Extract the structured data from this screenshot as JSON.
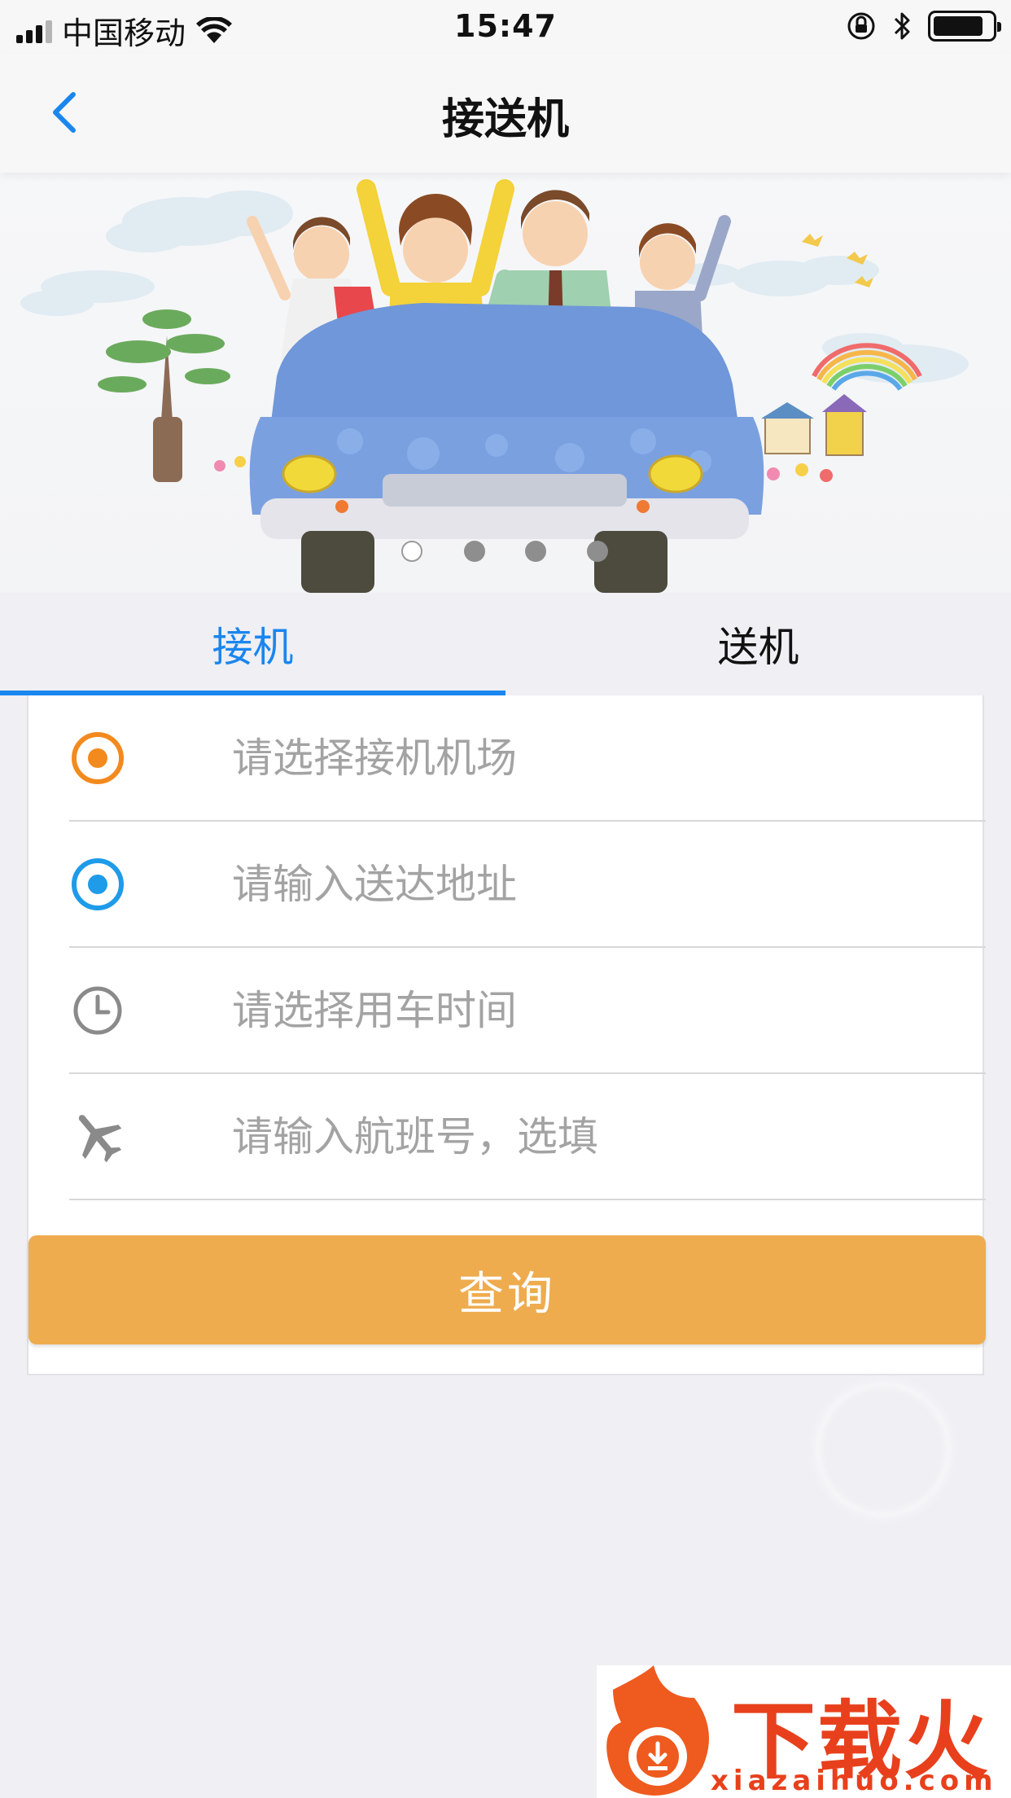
{
  "status_bar": {
    "carrier": "中国移动",
    "time": "15:47"
  },
  "nav": {
    "title": "接送机"
  },
  "banner": {
    "slide_count": 4,
    "active_index": 0
  },
  "tabs": [
    {
      "label": "接机",
      "active": true
    },
    {
      "label": "送机",
      "active": false
    }
  ],
  "form": {
    "rows": [
      {
        "icon": "pickup-airport-dot-icon",
        "placeholder": "请选择接机机场",
        "value": ""
      },
      {
        "icon": "destination-dot-icon",
        "placeholder": "请输入送达地址",
        "value": ""
      },
      {
        "icon": "clock-icon",
        "placeholder": "请选择用车时间",
        "value": ""
      },
      {
        "icon": "airplane-icon",
        "placeholder": "请输入航班号，选填",
        "value": ""
      }
    ],
    "submit_label": "查询"
  },
  "watermark": {
    "brand": "下载火",
    "url": "xiazaihuo.com"
  },
  "colors": {
    "accent_blue": "#1a86ee",
    "orange_dot": "#f38a1e",
    "blue_dot": "#1e9be9",
    "button": "#eeac4f",
    "background": "#efeff4"
  }
}
